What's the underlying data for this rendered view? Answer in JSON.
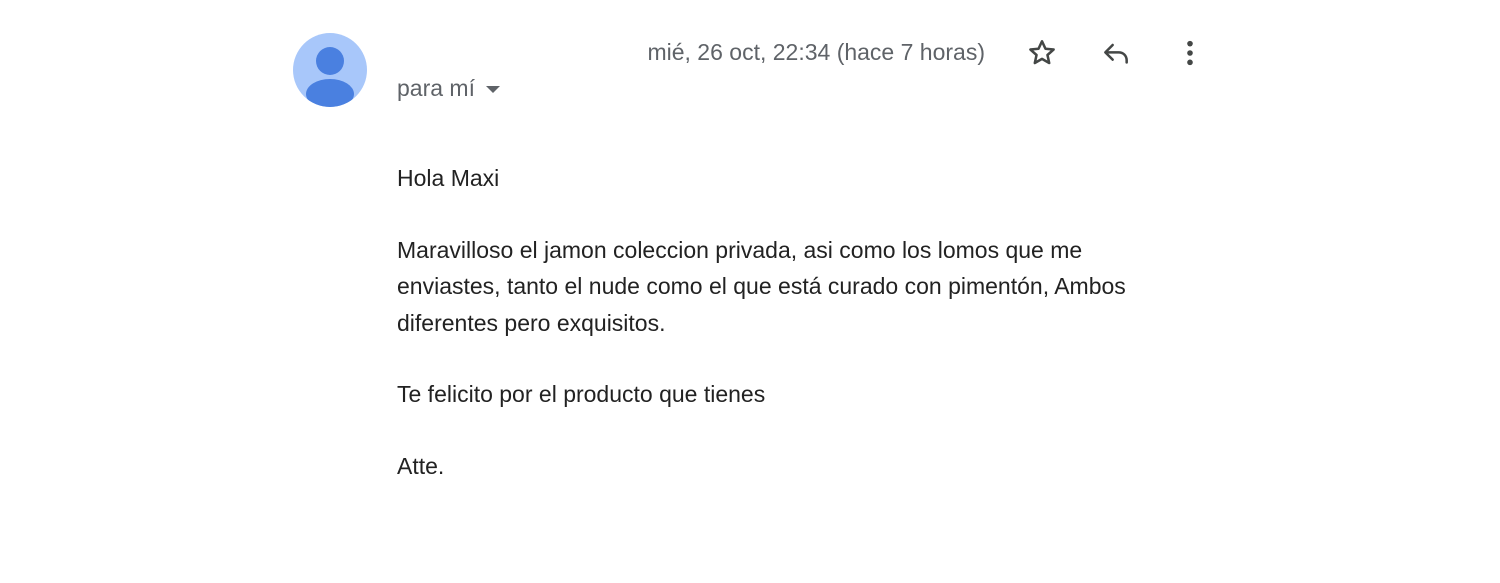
{
  "message": {
    "date": "mié, 26 oct, 22:34 (hace 7 horas)",
    "recipient_label": "para mí",
    "greeting": "Hola Maxi",
    "paragraph_1": "Maravilloso el jamon coleccion privada, asi como los lomos que me enviastes, tanto el nude como el que está curado con pimentón, Ambos diferentes pero exquisitos.",
    "paragraph_2": "Te felicito por el producto que tienes",
    "signoff": "Atte."
  },
  "icons": {
    "avatar": "person-avatar-icon",
    "star": "star-icon",
    "reply": "reply-icon",
    "more": "more-vertical-icon",
    "recipient_dropdown": "caret-down-icon"
  },
  "colors": {
    "avatar_background": "#a8c7fa",
    "avatar_figure": "#4a80e0",
    "secondary_text": "#5f6368",
    "body_text": "#222222"
  }
}
